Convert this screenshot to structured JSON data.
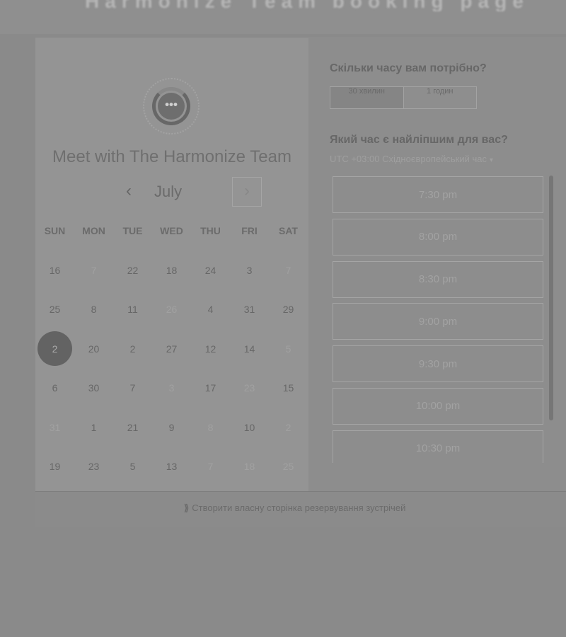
{
  "header": {
    "background_text": "Harmonize Team booking page"
  },
  "scheduler": {
    "title": "Meet with The Harmonize Team",
    "logo_dots": "•••",
    "month": "July",
    "prev_icon": "‹",
    "next_icon": "›",
    "weekdays": [
      "SUN",
      "MON",
      "TUE",
      "WED",
      "THU",
      "FRI",
      "SAT"
    ],
    "dates": [
      {
        "text": "16",
        "state": "normal"
      },
      {
        "text": "7",
        "state": "faded"
      },
      {
        "text": "22",
        "state": "normal"
      },
      {
        "text": "18",
        "state": "normal"
      },
      {
        "text": "24",
        "state": "normal"
      },
      {
        "text": "3",
        "state": "normal"
      },
      {
        "text": "7",
        "state": "faded"
      },
      {
        "text": "25",
        "state": "normal"
      },
      {
        "text": "8",
        "state": "normal"
      },
      {
        "text": "11",
        "state": "normal"
      },
      {
        "text": "26",
        "state": "faded"
      },
      {
        "text": "4",
        "state": "normal"
      },
      {
        "text": "31",
        "state": "normal"
      },
      {
        "text": "29",
        "state": "normal"
      },
      {
        "text": "2",
        "state": "selected"
      },
      {
        "text": "20",
        "state": "normal"
      },
      {
        "text": "2",
        "state": "normal"
      },
      {
        "text": "27",
        "state": "normal"
      },
      {
        "text": "12",
        "state": "normal"
      },
      {
        "text": "14",
        "state": "normal"
      },
      {
        "text": "5",
        "state": "faded"
      },
      {
        "text": "6",
        "state": "normal"
      },
      {
        "text": "30",
        "state": "normal"
      },
      {
        "text": "7",
        "state": "normal"
      },
      {
        "text": "3",
        "state": "faded"
      },
      {
        "text": "17",
        "state": "normal"
      },
      {
        "text": "23",
        "state": "faded"
      },
      {
        "text": "15",
        "state": "normal"
      },
      {
        "text": "31",
        "state": "faded"
      },
      {
        "text": "1",
        "state": "normal"
      },
      {
        "text": "21",
        "state": "normal"
      },
      {
        "text": "9",
        "state": "normal"
      },
      {
        "text": "8",
        "state": "faded"
      },
      {
        "text": "10",
        "state": "normal"
      },
      {
        "text": "2",
        "state": "faded"
      },
      {
        "text": "19",
        "state": "normal"
      },
      {
        "text": "23",
        "state": "normal"
      },
      {
        "text": "5",
        "state": "normal"
      },
      {
        "text": "13",
        "state": "normal"
      },
      {
        "text": "7",
        "state": "faded"
      },
      {
        "text": "18",
        "state": "faded"
      },
      {
        "text": "25",
        "state": "faded"
      }
    ]
  },
  "booking": {
    "question_duration": "Скільки часу вам потрібно?",
    "durations": [
      "30 хвилин",
      "1 годин"
    ],
    "question_time": "Який час є найліпшим для вас?",
    "timezone": "UTC +03:00 Східноєвропейський час",
    "timezone_caret": "▾",
    "slots": [
      "7:30 pm",
      "8:00 pm",
      "8:30 pm",
      "9:00 pm",
      "9:30 pm",
      "10:00 pm",
      "10:30 pm"
    ]
  },
  "footer": {
    "icon": "⟫",
    "link_text": "Створити власну сторінка резервування зустрічей"
  },
  "colors": {
    "overlay": "#8a8a8a",
    "panel": "#949494",
    "selected_day": "#636363"
  }
}
